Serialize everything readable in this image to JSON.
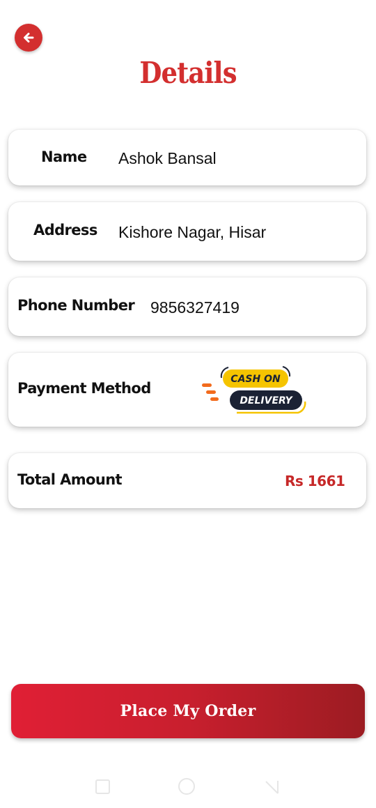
{
  "header": {
    "title": "Details",
    "back_icon": "arrow-left-icon"
  },
  "details": {
    "name": {
      "label": "Name",
      "value": "Ashok Bansal"
    },
    "address": {
      "label": "Address",
      "value": "Kishore Nagar, Hisar"
    },
    "phone": {
      "label": "Phone Number",
      "value": "9856327419"
    },
    "payment": {
      "label": "Payment Method",
      "logo_line1": "CASH ON",
      "logo_line2": "DELIVERY"
    },
    "total": {
      "label": "Total Amount",
      "value": "Rs 1661"
    }
  },
  "actions": {
    "place_order_label": "Place My Order"
  },
  "colors": {
    "accent": "#d32f2f",
    "amount": "#c62828",
    "button_gradient_start": "#e01f35",
    "button_gradient_end": "#9c1c22",
    "logo_yellow": "#f5c400",
    "logo_navy": "#1b2234",
    "logo_orange": "#f26b1d"
  },
  "nav": {
    "icons": [
      "recent-apps-icon",
      "home-icon",
      "back-triangle-icon"
    ]
  }
}
